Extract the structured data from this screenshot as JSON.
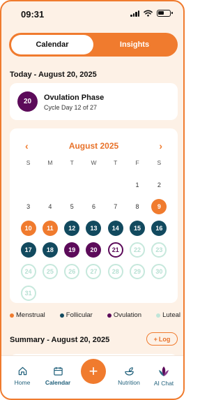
{
  "status_bar": {
    "time": "09:31"
  },
  "tabs": [
    {
      "label": "Calendar",
      "active": true
    },
    {
      "label": "Insights",
      "active": false
    }
  ],
  "today_title": "Today - August 20, 2025",
  "phase_card": {
    "day": "20",
    "phase": "Ovulation Phase",
    "cycle": "Cycle Day 12 of 27"
  },
  "calendar": {
    "prev_icon": "chevron-left-icon",
    "next_icon": "chevron-right-icon",
    "month": "August 2025",
    "weekdays": [
      "S",
      "M",
      "T",
      "W",
      "T",
      "F",
      "S"
    ],
    "days": [
      {
        "n": "",
        "p": "blank"
      },
      {
        "n": "",
        "p": "blank"
      },
      {
        "n": "",
        "p": "blank"
      },
      {
        "n": "",
        "p": "blank"
      },
      {
        "n": "",
        "p": "blank"
      },
      {
        "n": "1",
        "p": "none"
      },
      {
        "n": "2",
        "p": "none"
      },
      {
        "n": "3",
        "p": "none"
      },
      {
        "n": "4",
        "p": "none"
      },
      {
        "n": "5",
        "p": "none"
      },
      {
        "n": "6",
        "p": "none"
      },
      {
        "n": "7",
        "p": "none"
      },
      {
        "n": "8",
        "p": "none"
      },
      {
        "n": "9",
        "p": "menstrual"
      },
      {
        "n": "10",
        "p": "menstrual"
      },
      {
        "n": "11",
        "p": "menstrual"
      },
      {
        "n": "12",
        "p": "follicular"
      },
      {
        "n": "13",
        "p": "follicular"
      },
      {
        "n": "14",
        "p": "follicular"
      },
      {
        "n": "15",
        "p": "follicular"
      },
      {
        "n": "16",
        "p": "follicular"
      },
      {
        "n": "17",
        "p": "follicular"
      },
      {
        "n": "18",
        "p": "follicular"
      },
      {
        "n": "19",
        "p": "ovulation"
      },
      {
        "n": "20",
        "p": "ovulation"
      },
      {
        "n": "21",
        "p": "today"
      },
      {
        "n": "22",
        "p": "luteal"
      },
      {
        "n": "23",
        "p": "luteal"
      },
      {
        "n": "24",
        "p": "luteal"
      },
      {
        "n": "25",
        "p": "luteal"
      },
      {
        "n": "26",
        "p": "luteal"
      },
      {
        "n": "27",
        "p": "luteal"
      },
      {
        "n": "28",
        "p": "luteal"
      },
      {
        "n": "29",
        "p": "luteal"
      },
      {
        "n": "30",
        "p": "luteal"
      },
      {
        "n": "31",
        "p": "luteal"
      }
    ]
  },
  "legend": [
    {
      "label": "Menstrual",
      "color": "#f07b2e"
    },
    {
      "label": "Follicular",
      "color": "#124a5f"
    },
    {
      "label": "Ovulation",
      "color": "#5c0b5a"
    },
    {
      "label": "Luteal",
      "color": "#bfe5d8"
    }
  ],
  "summary": {
    "title": "Summary - August 20, 2025",
    "log_label": "Log",
    "log_icon": "plus-icon"
  },
  "nav": {
    "home": "Home",
    "calendar": "Calendar",
    "add_icon": "plus-icon",
    "nutrition": "Nutrition",
    "ai_chat": "AI Chat"
  },
  "colors": {
    "accent": "#f07b2e",
    "ovulation": "#5c0b5a",
    "follicular": "#124a5f",
    "luteal": "#bfe5d8",
    "background": "#fdf1e6"
  }
}
